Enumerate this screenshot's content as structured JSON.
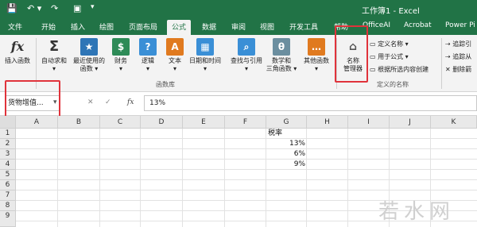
{
  "titlebar": {
    "save_icon": "save-icon",
    "undo_icon": "undo-icon",
    "redo_icon": "redo-icon",
    "camera_icon": "camera-icon",
    "title": "工作簿1 - Excel"
  },
  "tabs": [
    "文件",
    "开始",
    "插入",
    "绘图",
    "页面布局",
    "公式",
    "数据",
    "审阅",
    "视图",
    "开发工具",
    "帮助",
    "OfficeAI",
    "Acrobat",
    "Power Pi"
  ],
  "active_tab": "公式",
  "ribbon": {
    "insert_function": "插入函数",
    "autosum": [
      "自动求和",
      "▾"
    ],
    "recent": [
      "最近使用的",
      "函数 ▾"
    ],
    "finance": [
      "财务",
      "▾"
    ],
    "logic": [
      "逻辑",
      "▾"
    ],
    "text": [
      "文本",
      "▾"
    ],
    "datetime": [
      "日期和时间",
      "▾"
    ],
    "lookup": [
      "查找与引用",
      "▾"
    ],
    "math": [
      "数学和",
      "三角函数 ▾"
    ],
    "other": [
      "其他函数",
      "▾"
    ],
    "group_library": "函数库",
    "name_manager": [
      "名称",
      "管理器"
    ],
    "define_name": "定义名称 ▾",
    "use_in_formula": "用于公式 ▾",
    "create_from_selection": "根据所选内容创建",
    "group_defined_names": "定义的名称",
    "trace_precedents": "追踪引",
    "trace_dependents": "追踪从",
    "remove_arrows": "删除箭"
  },
  "formula_bar": {
    "name_box": "货物增值...",
    "cancel": "✕",
    "enter": "✓",
    "fx": "fx",
    "formula": "13%"
  },
  "columns": [
    "A",
    "B",
    "C",
    "D",
    "E",
    "F",
    "G",
    "H",
    "I",
    "J",
    "K"
  ],
  "rows": [
    "1",
    "2",
    "3",
    "4",
    "5",
    "6",
    "7",
    "8",
    "9"
  ],
  "cells": {
    "G1": "税率",
    "G2": "13%",
    "G3": "6%",
    "G4": "9%"
  },
  "watermark": "若水网"
}
